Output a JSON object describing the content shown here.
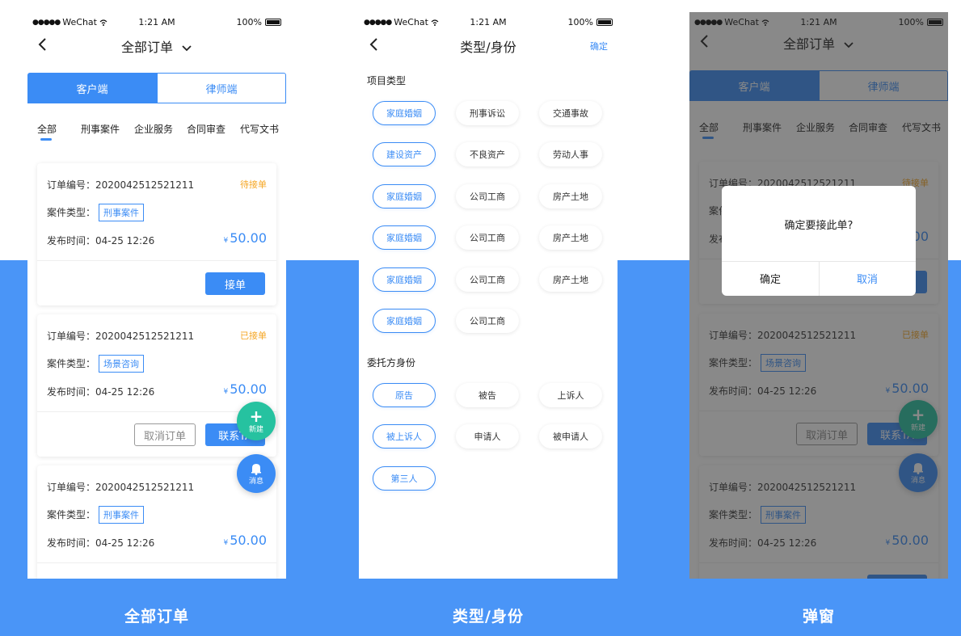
{
  "colors": {
    "accent": "#3b8cf5",
    "pending": "#f5a623",
    "fab_new": "#26c2a0",
    "fab_msg": "#3b8cf5",
    "band": "#4a95f7"
  },
  "status_bar": {
    "carrier": "WeChat",
    "time": "1:21 AM",
    "battery": "100%"
  },
  "screens": [
    {
      "caption": "全部订单",
      "nav_title": "全部订单",
      "segments": [
        "客户端",
        "律师端"
      ],
      "tabs": [
        "全部",
        "刑事案件",
        "企业服务",
        "合同审查",
        "代写文书"
      ],
      "orders": [
        {
          "order_no_label": "订单编号：2020042512521211",
          "status": "待接单",
          "type_label": "案件类型：",
          "type_tag": "刑事案件",
          "time_label": "发布时间：04-25  12:26",
          "currency": "¥",
          "price": "50.00",
          "actions": [
            "接单"
          ]
        },
        {
          "order_no_label": "订单编号：2020042512521211",
          "status": "已接单",
          "type_label": "案件类型：",
          "type_tag": "场景咨询",
          "time_label": "发布时间：04-25  12:26",
          "currency": "¥",
          "price": "50.00",
          "actions": [
            "取消订单",
            "联系TA"
          ]
        },
        {
          "order_no_label": "订单编号：2020042512521211",
          "status": "",
          "type_label": "案件类型：",
          "type_tag": "刑事案件",
          "time_label": "发布时间：04-25  12:26",
          "currency": "¥",
          "price": "50.00",
          "actions": []
        }
      ],
      "fab_new": "新建",
      "fab_msg": "消息"
    },
    {
      "caption": "类型/身份",
      "nav_title": "类型/身份",
      "confirm": "确定",
      "project_section": "项目类型",
      "project_chips": [
        [
          "家庭婚姻",
          "刑事诉讼",
          "交通事故"
        ],
        [
          "建设资产",
          "不良资产",
          "劳动人事"
        ],
        [
          "家庭婚姻",
          "公司工商",
          "房产土地"
        ],
        [
          "家庭婚姻",
          "公司工商",
          "房产土地"
        ],
        [
          "家庭婚姻",
          "公司工商",
          "房产土地"
        ],
        [
          "家庭婚姻",
          "公司工商"
        ]
      ],
      "client_section": "委托方身份",
      "client_chips": [
        [
          "原告",
          "被告",
          "上诉人"
        ],
        [
          "被上诉人",
          "申请人",
          "被申请人"
        ],
        [
          "第三人"
        ]
      ]
    },
    {
      "caption": "弹窗",
      "dialog": {
        "message": "确定要接此单?",
        "ok": "确定",
        "cancel": "取消"
      }
    }
  ]
}
